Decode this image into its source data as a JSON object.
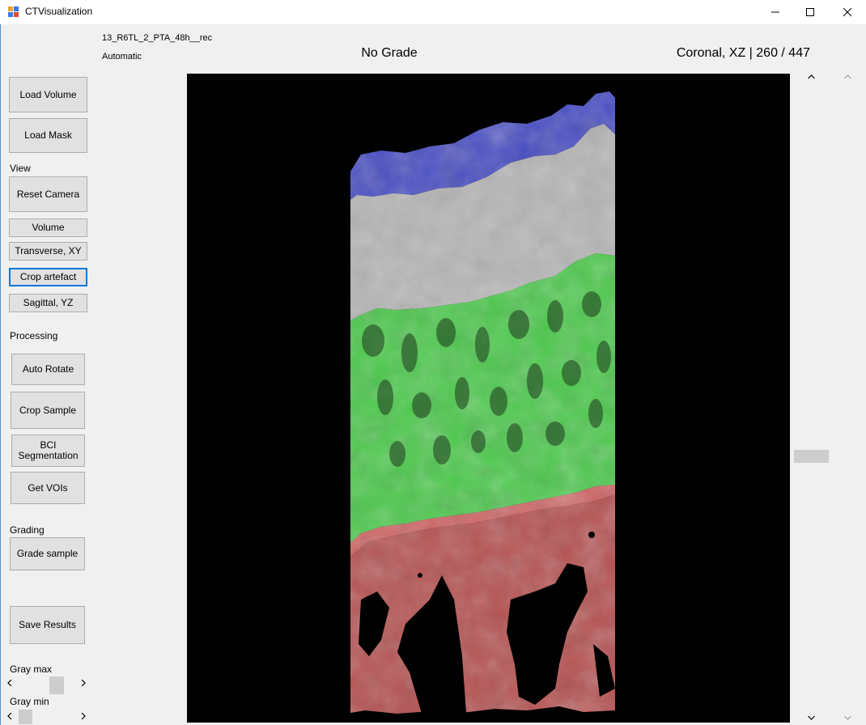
{
  "window": {
    "title": "CTVisualization",
    "minimize_icon": "minimize-icon",
    "maximize_icon": "maximize-icon",
    "close_icon": "close-icon"
  },
  "info": {
    "filename": "13_R6TL_2_PTA_48h__rec",
    "mode": "Automatic",
    "grade": "No Grade",
    "view_status": "Coronal, XZ | 260 / 447"
  },
  "buttons": {
    "load_volume": "Load Volume",
    "load_mask": "Load Mask",
    "reset_camera": "Reset Camera",
    "volume": "Volume",
    "transverse": "Transverse, XY",
    "crop_artefact": "Crop artefact",
    "sagittal": "Sagittal, YZ",
    "auto_rotate": "Auto Rotate",
    "crop_sample": "Crop Sample",
    "bci_segmentation": "BCI Segmentation",
    "get_vois": "Get VOIs",
    "grade_sample": "Grade sample",
    "save_results": "Save Results"
  },
  "sections": {
    "view": "View",
    "processing": "Processing",
    "grading": "Grading",
    "gray_max": "Gray max",
    "gray_min": "Gray min"
  },
  "scrollbars": {
    "slice": {
      "value": 260,
      "max": 447
    },
    "gray_max_fraction": 0.62,
    "gray_min_fraction": 0.0
  },
  "image": {
    "description_colors": {
      "background": "#000000",
      "surface_label": "#4a4fc4",
      "gray_tissue": "#b8b8b8",
      "green_label": "#4cc94c",
      "red_label": "#c85a5a"
    }
  }
}
